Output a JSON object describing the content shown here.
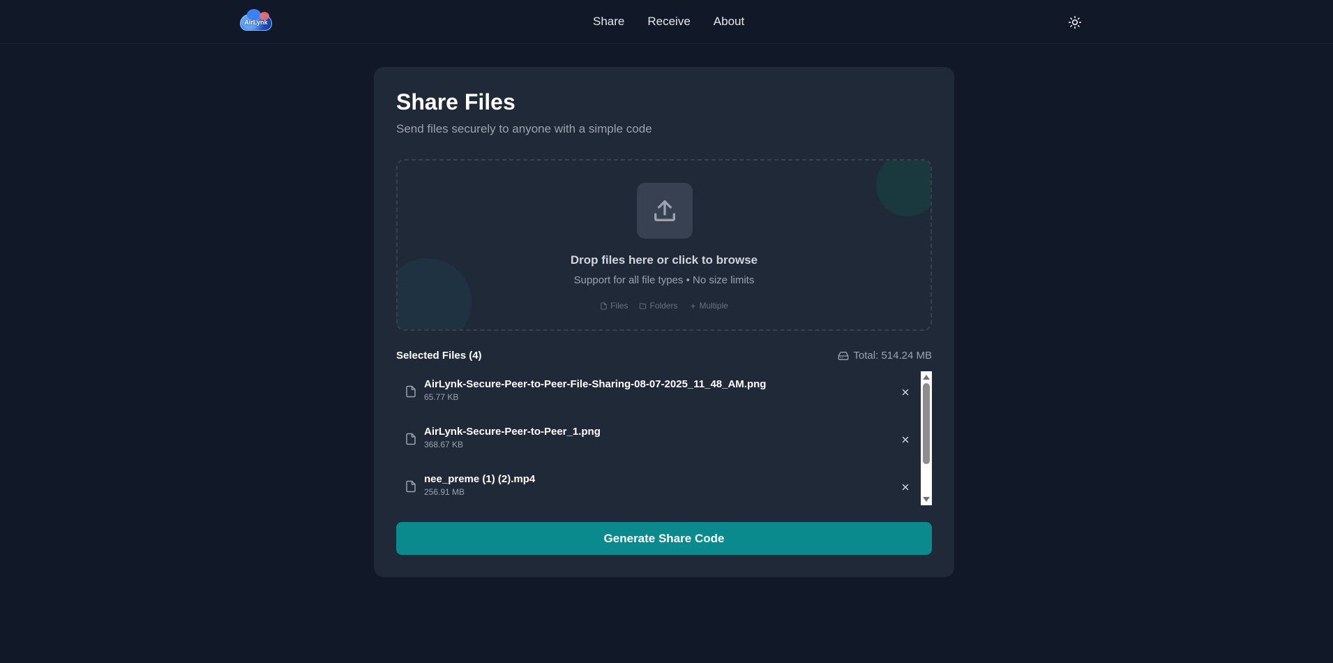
{
  "brand": {
    "logo_text": "AirLynk"
  },
  "nav": {
    "items": [
      {
        "label": "Share"
      },
      {
        "label": "Receive"
      },
      {
        "label": "About"
      }
    ],
    "theme_icon": "sun-icon"
  },
  "share": {
    "title": "Share Files",
    "subtitle": "Send files securely to anyone with a simple code",
    "dropzone": {
      "icon": "upload-icon",
      "title": "Drop files here or click to browse",
      "subtitle": "Support for all file types • No size limits",
      "hints": [
        {
          "icon": "file-icon",
          "label": "Files"
        },
        {
          "icon": "folder-icon",
          "label": "Folders"
        },
        {
          "icon": "plus-icon",
          "label": "Multiple"
        }
      ]
    },
    "selected": {
      "title": "Selected Files (4)",
      "total_icon": "hard-drive-icon",
      "total_label": "Total: 514.24 MB",
      "files": [
        {
          "name": "AirLynk-Secure-Peer-to-Peer-File-Sharing-08-07-2025_11_48_AM.png",
          "size": "65.77 KB"
        },
        {
          "name": "AirLynk-Secure-Peer-to-Peer_1.png",
          "size": "368.67 KB"
        },
        {
          "name": "nee_preme (1) (2).mp4",
          "size": "256.91 MB"
        }
      ]
    },
    "generate_label": "Generate Share Code"
  },
  "colors": {
    "background": "#111827",
    "card": "#1f2937",
    "accent": "#0a8a8c"
  }
}
